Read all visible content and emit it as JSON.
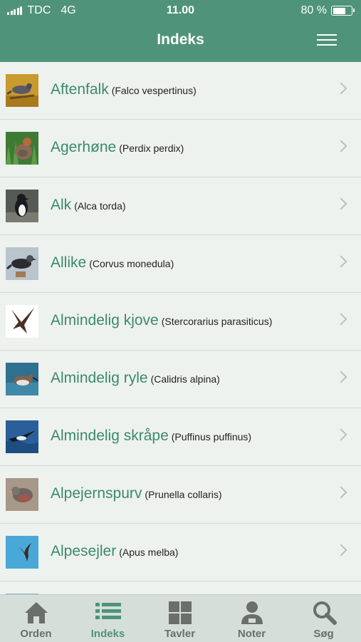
{
  "status_bar": {
    "carrier": "TDC",
    "network": "4G",
    "time": "11.00",
    "battery": "80 %",
    "battery_level": 0.8
  },
  "header": {
    "title": "Indeks",
    "menu_icon": "hamburger-menu-icon"
  },
  "colors": {
    "header_bg": "#4f937a",
    "name_text": "#3b8a6a",
    "active_tab": "#4f937a",
    "inactive_tab": "#6a6f6c"
  },
  "birds": [
    {
      "name": "Aftenfalk",
      "latin": "(Falco vespertinus)"
    },
    {
      "name": "Agerhøne",
      "latin": "(Perdix perdix)"
    },
    {
      "name": "Alk",
      "latin": "(Alca torda)"
    },
    {
      "name": "Allike",
      "latin": "(Corvus monedula)"
    },
    {
      "name": "Almindelig kjove",
      "latin": "(Stercorarius parasiticus)"
    },
    {
      "name": "Almindelig ryle",
      "latin": "(Calidris alpina)"
    },
    {
      "name": "Almindelig skråpe",
      "latin": "(Puffinus puffinus)"
    },
    {
      "name": "Alpejernspurv",
      "latin": "(Prunella collaris)"
    },
    {
      "name": "Alpesejler",
      "latin": "(Apus melba)"
    }
  ],
  "tabs": [
    {
      "label": "Orden",
      "icon": "house-icon",
      "active": false
    },
    {
      "label": "Indeks",
      "icon": "list-icon",
      "active": true
    },
    {
      "label": "Tavler",
      "icon": "grid-icon",
      "active": false
    },
    {
      "label": "Noter",
      "icon": "person-icon",
      "active": false
    },
    {
      "label": "Søg",
      "icon": "search-icon",
      "active": false
    }
  ]
}
